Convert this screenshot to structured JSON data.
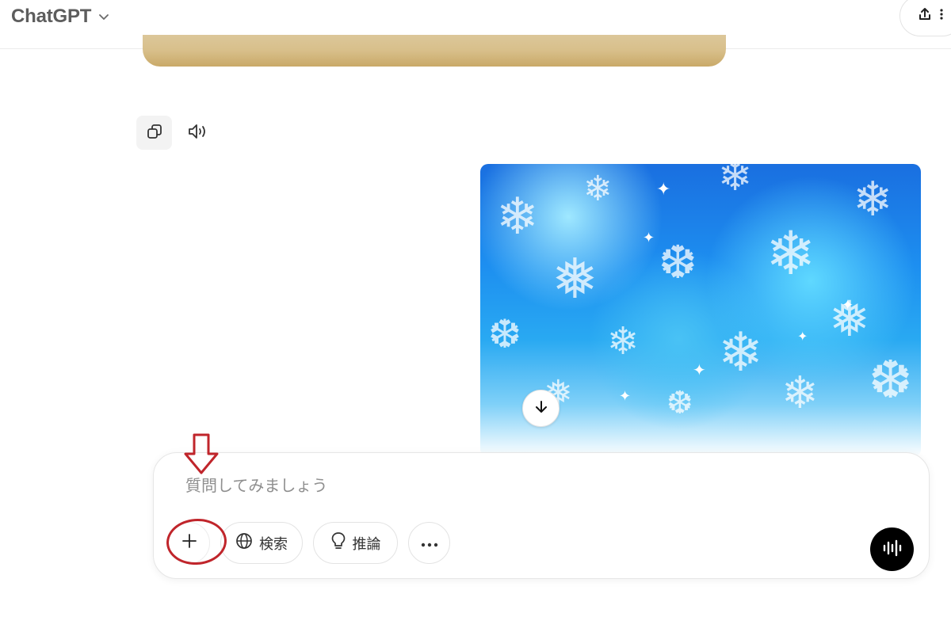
{
  "header": {
    "model_name": "ChatGPT"
  },
  "composer": {
    "placeholder": "質問してみましょう",
    "tools": {
      "search_label": "検索",
      "reason_label": "推論"
    }
  },
  "colors": {
    "annotation": "#c0252b",
    "voice_button": "#000000"
  },
  "icons": {
    "model_chevron": "chevron-down-icon",
    "share": "share-icon",
    "more": "kebab-icon",
    "copy": "copy-icon",
    "read_aloud": "speaker-icon",
    "scroll_down": "arrow-down-icon",
    "attach": "plus-icon",
    "search": "globe-icon",
    "reason": "lightbulb-icon",
    "tools_more": "ellipsis-icon",
    "voice": "voice-wave-icon"
  }
}
